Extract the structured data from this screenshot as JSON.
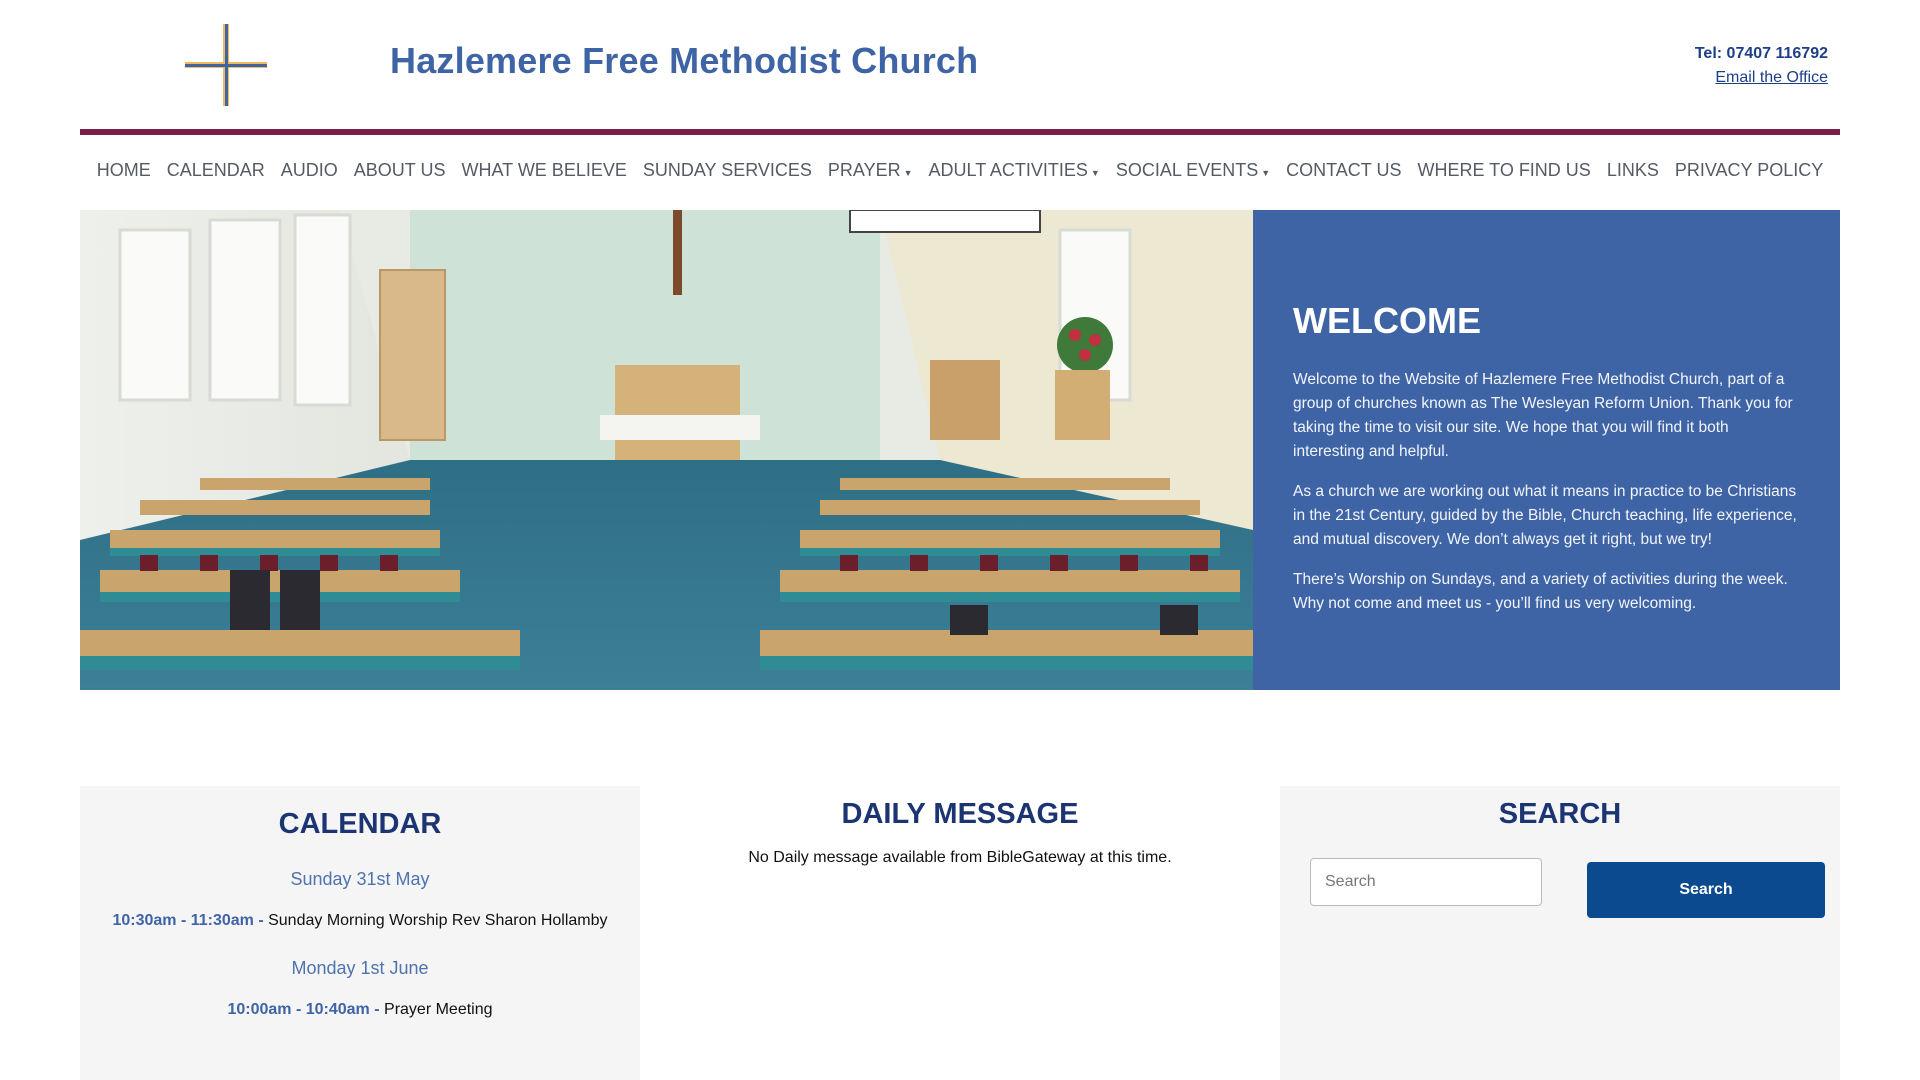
{
  "site": {
    "title": "Hazlemere Free Methodist Church",
    "tel": "Tel: 07407 116792",
    "email_link": "Email the Office"
  },
  "nav": {
    "items": [
      {
        "label": "HOME",
        "dropdown": false
      },
      {
        "label": "CALENDAR",
        "dropdown": false
      },
      {
        "label": "AUDIO",
        "dropdown": false
      },
      {
        "label": "ABOUT US",
        "dropdown": false
      },
      {
        "label": "WHAT WE BELIEVE",
        "dropdown": false
      },
      {
        "label": "SUNDAY SERVICES",
        "dropdown": false
      },
      {
        "label": "PRAYER",
        "dropdown": true
      },
      {
        "label": "ADULT ACTIVITIES",
        "dropdown": true
      },
      {
        "label": "SOCIAL EVENTS",
        "dropdown": true
      },
      {
        "label": "CONTACT US",
        "dropdown": false
      },
      {
        "label": "WHERE TO FIND US",
        "dropdown": false
      },
      {
        "label": "LINKS",
        "dropdown": false
      },
      {
        "label": "PRIVACY POLICY",
        "dropdown": false
      }
    ],
    "caret": "▼"
  },
  "hero": {
    "title": "WELCOME",
    "paragraphs": [
      "Welcome to the Website of Hazlemere Free Methodist Church, part of a group of churches known as The Wesleyan Reform Union. Thank you for taking the time to visit our site. We hope that you will find it both interesting and helpful.",
      "As a church we are working out what it means in practice to be Christians in the 21st Century, guided by the Bible, Church teaching, life experience, and mutual discovery. We don’t always get it right, but we try!",
      "There’s Worship on Sundays, and a variety of activities during the week. Why not come and meet us - you’ll find us very welcoming."
    ]
  },
  "calendar": {
    "title": "CALENDAR",
    "days": [
      {
        "date": "Sunday 31st May",
        "events": [
          {
            "time": "10:30am - 11:30am -",
            "title": "Sunday Morning Worship Rev Sharon Hollamby"
          }
        ]
      },
      {
        "date": "Monday 1st June",
        "events": [
          {
            "time": "10:00am - 10:40am -",
            "title": "Prayer Meeting"
          }
        ]
      }
    ]
  },
  "daily_message": {
    "title": "DAILY MESSAGE",
    "text": "No Daily message available from BibleGateway at this time."
  },
  "search": {
    "title": "SEARCH",
    "placeholder": "Search",
    "button_label": "Search"
  },
  "colors": {
    "brand_blue": "#3f64a6",
    "rule_maroon": "#7a1f4a",
    "button_blue": "#0c4a90",
    "heading_navy": "#1c3572"
  }
}
